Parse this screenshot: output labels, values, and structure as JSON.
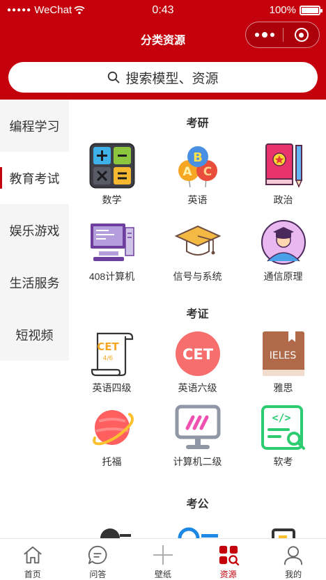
{
  "status_bar": {
    "signal": "●●●●●",
    "carrier": "WeChat",
    "time": "0:43",
    "battery": "100%"
  },
  "nav": {
    "title": "分类资源"
  },
  "search": {
    "placeholder": "搜索模型、资源"
  },
  "sidebar": {
    "items": [
      {
        "label": "编程学习"
      },
      {
        "label": "教育考试",
        "active": true
      },
      {
        "label": "娱乐游戏"
      },
      {
        "label": "生活服务"
      },
      {
        "label": "短视频"
      }
    ]
  },
  "sections": [
    {
      "title": "考研",
      "items": [
        {
          "label": "数学",
          "icon": "calculator-icon"
        },
        {
          "label": "英语",
          "icon": "abc-balloons-icon"
        },
        {
          "label": "政治",
          "icon": "red-book-pencil-icon"
        },
        {
          "label": "408计算机",
          "icon": "computer-monitor-icon"
        },
        {
          "label": "信号与系统",
          "icon": "graduation-cap-icon"
        },
        {
          "label": "通信原理",
          "icon": "graduate-avatar-icon"
        }
      ]
    },
    {
      "title": "考证",
      "items": [
        {
          "label": "英语四级",
          "icon": "cet-scroll-icon",
          "text": "CET",
          "subtext": "4/6"
        },
        {
          "label": "英语六级",
          "icon": "cet-circle-icon",
          "text": "CET"
        },
        {
          "label": "雅思",
          "icon": "ieles-book-icon",
          "text": "IELES"
        },
        {
          "label": "托福",
          "icon": "planet-icon"
        },
        {
          "label": "计算机二级",
          "icon": "monitor-slashes-icon"
        },
        {
          "label": "软考",
          "icon": "code-document-search-icon",
          "text": "</>"
        }
      ]
    },
    {
      "title": "考公",
      "items": []
    }
  ],
  "tabbar": {
    "items": [
      {
        "label": "首页",
        "icon": "home-icon"
      },
      {
        "label": "问答",
        "icon": "chat-bubble-icon"
      },
      {
        "label": "壁纸",
        "icon": "plus-icon"
      },
      {
        "label": "资源",
        "icon": "grid-search-icon",
        "active": true
      },
      {
        "label": "我的",
        "icon": "person-icon"
      }
    ]
  },
  "colors": {
    "primary": "#c4000c",
    "sidebar_bg": "#f5f5f5",
    "text": "#333333"
  }
}
